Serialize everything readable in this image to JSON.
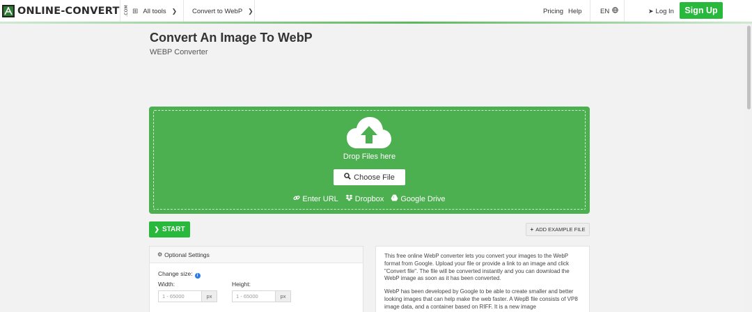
{
  "header": {
    "logo_text": "ONLINE-CONVERT",
    "logo_tld": ".COM",
    "all_tools_label": "All tools",
    "convert_to_label": "Convert to WebP",
    "pricing_label": "Pricing",
    "help_label": "Help",
    "language_label": "EN",
    "login_label": "Log In",
    "signup_label": "Sign Up"
  },
  "page": {
    "title": "Convert An Image To WebP",
    "subtitle": "WEBP Converter"
  },
  "dropzone": {
    "drop_text": "Drop Files here",
    "choose_label": "Choose File",
    "sources": {
      "url": "Enter URL",
      "dropbox": "Dropbox",
      "gdrive": "Google Drive"
    }
  },
  "actions": {
    "start_label": "START",
    "example_label": "ADD EXAMPLE FILE"
  },
  "settings": {
    "title": "Optional Settings",
    "change_size_label": "Change size:",
    "width_label": "Width:",
    "height_label": "Height:",
    "width_placeholder": "1 - 65000",
    "height_placeholder": "1 - 65000",
    "unit": "px"
  },
  "description": {
    "paragraph1": "This free online WebP converter lets you convert your images to the WebP format from Google. Upload your file or provide a link to an image and click \"Convert file\". The file will be converted instantly and you can download the WebP image as soon as it has been converted.",
    "paragraph2": "WebP has been developed by Google to be able to create smaller and better looking images that can help make the web faster. A WepB file consists of VP8 image data, and a container based on RIFF. It is a new image"
  },
  "colors": {
    "brand_green": "#28b83c",
    "dropzone_green": "#4caf50",
    "info_blue": "#2a7de1"
  }
}
